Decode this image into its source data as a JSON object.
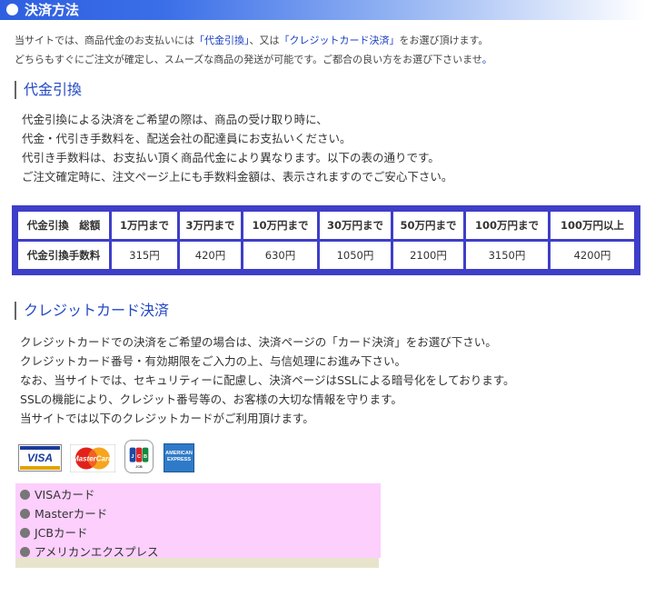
{
  "header": {
    "title": "決済方法"
  },
  "intro": {
    "line1_pre": "当サイトでは、商品代金のお支払いには",
    "line1_cod": "「代金引換」",
    "line1_mid": "、又は",
    "line1_card": "「クレジットカード決済」",
    "line1_post": "をお選び頂けます。",
    "line2": "どちらもすぐにご注文が確定し、スムーズな商品の発送が可能です。ご都合の良い方をお選び下さいませ",
    "line2_end": "。"
  },
  "cod": {
    "heading": "代金引換",
    "paragraphs": [
      "代金引換による決済をご希望の際は、商品の受け取り時に、",
      "代金・代引き手数料を、配送会社の配達員にお支払いください。",
      "代引き手数料は、お支払い頂く商品代金により異なります。以下の表の通りです。",
      "ご注文確定時に、注文ページ上にも手数料金額は、表示されますのでご安心下さい。"
    ],
    "table": {
      "header_row": [
        "代金引換　総額",
        "1万円まで",
        "3万円まで",
        "10万円まで",
        "30万円まで",
        "50万円まで",
        "100万円まで",
        "100万円以上"
      ],
      "fee_row": [
        "代金引換手数料",
        "315円",
        "420円",
        "630円",
        "1050円",
        "2100円",
        "3150円",
        "4200円"
      ]
    }
  },
  "credit": {
    "heading": "クレジットカード決済",
    "paragraphs": [
      "クレジットカードでの決済をご希望の場合は、決済ページの「カード決済」をお選び下さい。",
      "クレジットカード番号・有効期限をご入力の上、与信処理にお進み下さい。",
      "なお、当サイトでは、セキュリティーに配慮し、決済ページはSSLによる暗号化をしております。",
      "SSLの機能により、クレジット番号等の、お客様の大切な情報を守ります。",
      "当サイトでは以下のクレジットカードがご利用頂けます。"
    ],
    "logos": {
      "visa": "VISA",
      "mastercard": "MasterCard",
      "jcb": "JCB",
      "amex_line1": "AMERICAN",
      "amex_line2": "EXPRESS"
    },
    "cards": [
      "VISAカード",
      "Masterカード",
      "JCBカード",
      "アメリカンエクスプレス"
    ]
  }
}
